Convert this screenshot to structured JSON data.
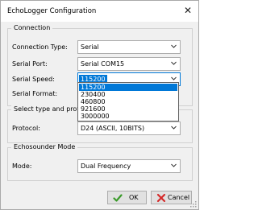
{
  "window": {
    "title": "EchoLogger Configuration",
    "close_glyph": "✕"
  },
  "connection": {
    "group_title": "Connection",
    "type_label": "Connection Type:",
    "type_value": "Serial",
    "port_label": "Serial Port:",
    "port_value": "Serial COM15",
    "speed_label": "Serial Speed:",
    "speed_value": "115200",
    "speed_options": [
      "115200",
      "230400",
      "460800",
      "921600",
      "3000000"
    ],
    "format_label": "Serial Format:"
  },
  "protocol": {
    "group_title": "Select type and protocol",
    "label": "Protocol:",
    "value": "D24 (ASCII, 10BITS)"
  },
  "echosounder": {
    "group_title": "Echosounder Mode",
    "label": "Mode:",
    "value": "Dual Frequency"
  },
  "buttons": {
    "ok_label": "OK",
    "cancel_label": "Cancel"
  },
  "colors": {
    "accent": "#0078d7",
    "ok_icon": "#3a9a2a",
    "cancel_icon": "#d42a2a"
  },
  "icons": {
    "close": "close-icon",
    "dropdown": "chevron-down-icon",
    "ok": "checkmark-icon",
    "cancel": "x-icon",
    "grip": "resize-grip-icon"
  }
}
